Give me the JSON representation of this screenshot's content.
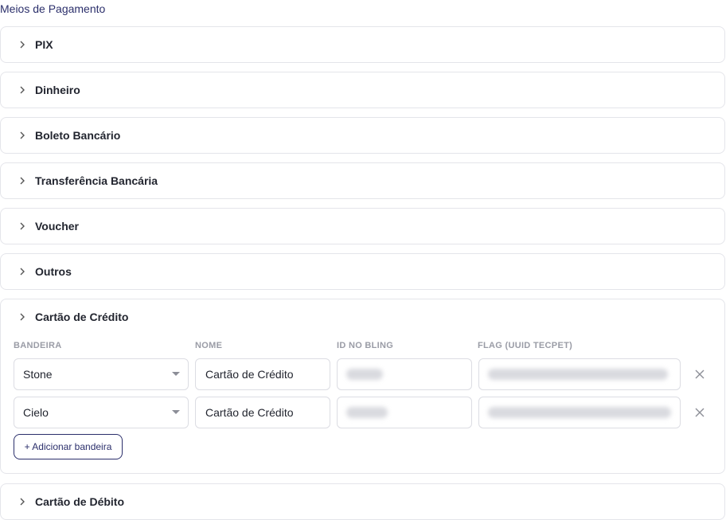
{
  "section_title": "Meios de Pagamento",
  "methods": [
    {
      "label": "PIX"
    },
    {
      "label": "Dinheiro"
    },
    {
      "label": "Boleto Bancário"
    },
    {
      "label": "Transferência Bancária"
    },
    {
      "label": "Voucher"
    },
    {
      "label": "Outros"
    }
  ],
  "credit_card": {
    "label": "Cartão de Crédito",
    "columns": {
      "bandeira": "BANDEIRA",
      "nome": "NOME",
      "id_bling": "ID NO BLING",
      "flag": "FLAG (UUID TECPET)"
    },
    "rows": [
      {
        "bandeira": "Stone",
        "nome": "Cartão de Crédito"
      },
      {
        "bandeira": "Cielo",
        "nome": "Cartão de Crédito"
      }
    ],
    "add_label": "+ Adicionar bandeira"
  },
  "debit_card": {
    "label": "Cartão de Débito"
  },
  "icons": {
    "chevron": "chevron-right-icon",
    "remove": "close-icon",
    "select": "caret-down-icon"
  },
  "colors": {
    "accent": "#2b2f6b",
    "border": "#e4e5ea"
  }
}
